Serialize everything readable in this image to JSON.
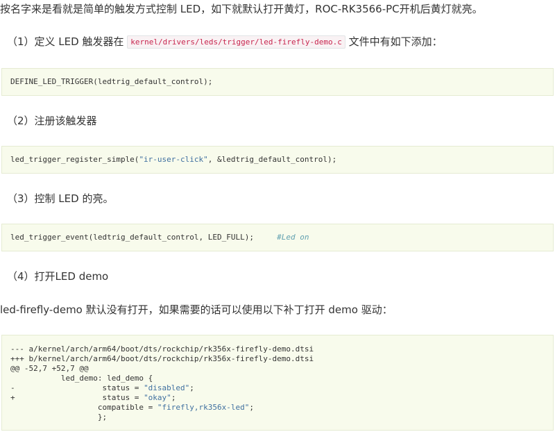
{
  "intro": "按名字来是看就是简单的触发方式控制 LED，如下就默认打开黄灯，ROC-RK3566-PC开机后黄灯就亮。",
  "step1": {
    "text_before": "（1）定义 LED 触发器在 ",
    "file_path": "kernel/drivers/leds/trigger/led-firefly-demo.c",
    "text_after": " 文件中有如下添加："
  },
  "code1": {
    "line": "DEFINE_LED_TRIGGER(ledtrig_default_control);"
  },
  "step2": "（2）注册该触发器",
  "code2": {
    "prefix": "led_trigger_register_simple(",
    "string": "\"ir-user-click\"",
    "suffix": ", &ledtrig_default_control);"
  },
  "step3": "（3）控制 LED 的亮。",
  "code3": {
    "code": "led_trigger_event(ledtrig_default_control, LED_FULL);     ",
    "comment": "#Led on"
  },
  "step4": "（4）打开LED demo",
  "patch_intro": "led-firefly-demo 默认没有打开，如果需要的话可以使用以下补丁打开 demo 驱动：",
  "patch": {
    "line1": "--- a/kernel/arch/arm64/boot/dts/rockchip/rk356x-firefly-demo.dtsi",
    "line2": "+++ b/kernel/arch/arm64/boot/dts/rockchip/rk356x-firefly-demo.dtsi",
    "line3": "@@ -52,7 +52,7 @@",
    "line4": "           led_demo: led_demo {",
    "line5_prefix": "-                   status = ",
    "line5_string": "\"disabled\"",
    "line5_suffix": ";",
    "line6_prefix": "+                   status = ",
    "line6_string": "\"okay\"",
    "line6_suffix": ";",
    "line7_prefix": "                   compatible = ",
    "line7_string": "\"firefly,rk356x-led\"",
    "line7_suffix": ";",
    "line8": "                   };"
  },
  "colors": {
    "code_background": "#f8fbec",
    "inline_code_text": "#c7254e",
    "string": "#4070a0",
    "comment": "#60a0b0"
  }
}
